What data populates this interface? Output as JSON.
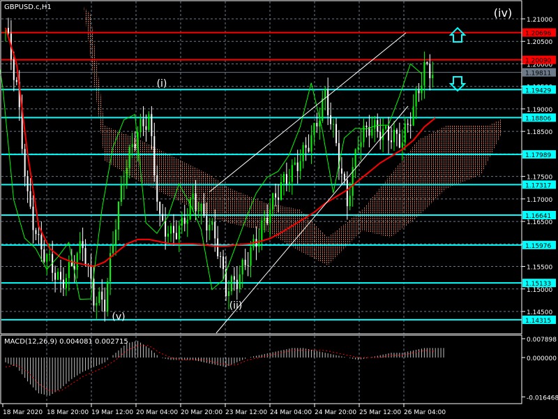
{
  "window": {
    "symbol_title": "GBPUSD.c,H1"
  },
  "wave_labels": {
    "i": "(i)",
    "ii": "(ii)",
    "iv": "(iv)",
    "v": "(v)"
  },
  "icons": {
    "up_arrow": "hollow-up-arrow",
    "down_arrow": "hollow-down-arrow"
  },
  "colors": {
    "background": "#000000",
    "level_cyan": "#00ffff",
    "level_red": "#ff0000",
    "current_price": "#6c7a89",
    "bull": "#00ff00",
    "bear": "#ffffff",
    "ma": "#ff0000",
    "kijun": "#0000ff",
    "cloud_up": "#ff8c5a",
    "cloud_down": "#f5f5f5"
  },
  "price_axis": {
    "ticks": [
      "1.21000",
      "1.20500",
      "1.20000",
      "1.19500",
      "1.19000",
      "1.18500",
      "1.18000",
      "1.17500",
      "1.17000",
      "1.16500",
      "1.16000",
      "1.15500",
      "1.15000",
      "1.14500"
    ],
    "current_price": "1.19811",
    "red_levels": [
      "1.20696",
      "1.20090"
    ],
    "cyan_levels": [
      "1.19429",
      "1.18806",
      "1.17989",
      "1.17317",
      "1.16641",
      "1.15976",
      "1.15133",
      "1.14315"
    ]
  },
  "macd": {
    "label": "MACD(12,26,9) 0.004081 0.002715",
    "ticks": [
      "0.007898",
      "0.000000",
      "-0.016468"
    ]
  },
  "time_axis": [
    "18 Mar 2020",
    "18 Mar 20:00",
    "19 Mar 12:00",
    "20 Mar 04:00",
    "20 Mar 20:00",
    "23 Mar 12:00",
    "24 Mar 04:00",
    "24 Mar 20:00",
    "25 Mar 12:00",
    "26 Mar 04:00"
  ],
  "chart_data": {
    "type": "line",
    "title": "GBPUSD.c,H1",
    "ylim": [
      1.1405,
      1.214
    ],
    "bar_index": [
      0,
      4,
      8,
      12,
      16,
      20,
      24,
      28,
      32,
      36,
      40,
      44,
      48,
      52,
      56,
      60,
      64,
      68,
      72,
      76,
      80,
      84,
      88,
      92,
      96,
      100,
      104,
      108,
      112,
      116,
      120,
      124,
      128,
      132,
      136,
      140,
      144,
      148,
      152,
      156
    ],
    "close": [
      1.208,
      1.195,
      1.17,
      1.16,
      1.156,
      1.151,
      1.155,
      1.16,
      1.148,
      1.147,
      1.165,
      1.178,
      1.185,
      1.188,
      1.165,
      1.162,
      1.164,
      1.17,
      1.166,
      1.162,
      1.15,
      1.152,
      1.157,
      1.162,
      1.168,
      1.173,
      1.176,
      1.18,
      1.185,
      1.193,
      1.182,
      1.169,
      1.183,
      1.186,
      1.185,
      1.184,
      1.183,
      1.19,
      1.199,
      1.1981
    ],
    "ma": [
      1.208,
      1.2,
      1.18,
      1.164,
      1.159,
      1.157,
      1.156,
      1.1555,
      1.155,
      1.156,
      1.158,
      1.16,
      1.161,
      1.161,
      1.1605,
      1.16,
      1.16,
      1.16,
      1.1598,
      1.1595,
      1.1595,
      1.1598,
      1.16,
      1.1605,
      1.1612,
      1.1625,
      1.164,
      1.1655,
      1.167,
      1.169,
      1.1705,
      1.172,
      1.174,
      1.176,
      1.178,
      1.1795,
      1.181,
      1.183,
      1.186,
      1.188
    ],
    "macd_hist": [
      -0.002,
      -0.004,
      -0.01,
      -0.015,
      -0.016,
      -0.013,
      -0.009,
      -0.006,
      -0.004,
      -0.002,
      0.002,
      0.006,
      0.007,
      0.004,
      0.0,
      -0.001,
      -0.001,
      -0.001,
      -0.002,
      -0.003,
      -0.004,
      -0.002,
      0.0,
      0.001,
      0.002,
      0.003,
      0.004,
      0.004,
      0.003,
      0.002,
      0.001,
      0.0,
      -0.001,
      0.0,
      0.001,
      0.002,
      0.002,
      0.003,
      0.004,
      0.004
    ],
    "macd_signal": [
      -0.004,
      -0.003,
      -0.006,
      -0.011,
      -0.014,
      -0.014,
      -0.011,
      -0.008,
      -0.006,
      -0.004,
      -0.001,
      0.003,
      0.005,
      0.005,
      0.002,
      0.0,
      -0.001,
      -0.001,
      -0.001,
      -0.002,
      -0.003,
      -0.003,
      -0.001,
      0.0,
      0.001,
      0.002,
      0.003,
      0.003,
      0.003,
      0.003,
      0.002,
      0.001,
      0.0,
      0.0,
      0.0,
      0.001,
      0.001,
      0.002,
      0.003,
      0.0027
    ]
  }
}
